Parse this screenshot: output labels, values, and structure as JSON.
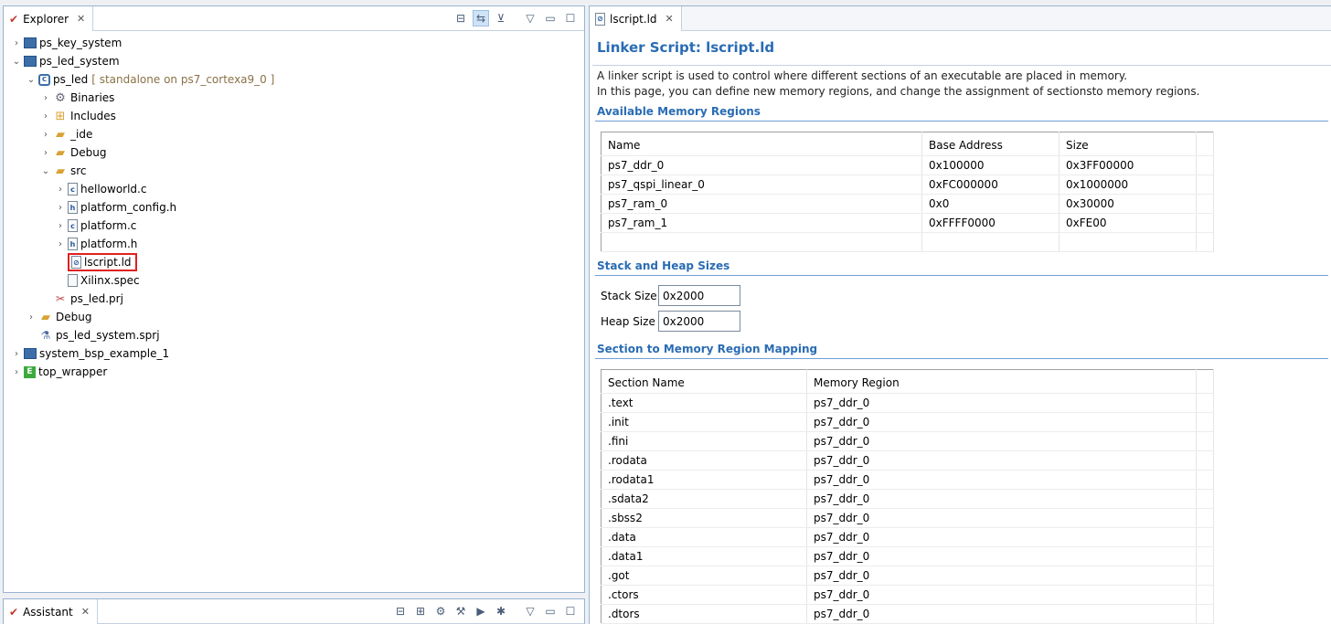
{
  "explorer": {
    "tab_label": "Explorer",
    "tree": [
      {
        "label": "ps_key_system",
        "muted": "",
        "icon": "system",
        "level": 0,
        "twisty": "›"
      },
      {
        "label": "ps_led_system",
        "muted": "",
        "icon": "system",
        "level": 0,
        "twisty": "⌄"
      },
      {
        "label": "ps_led",
        "muted": "[ standalone on ps7_cortexa9_0 ]",
        "icon": "application",
        "level": 1,
        "twisty": "⌄"
      },
      {
        "label": "Binaries",
        "muted": "",
        "icon": "gear",
        "level": 2,
        "twisty": "›"
      },
      {
        "label": "Includes",
        "muted": "",
        "icon": "includes",
        "level": 2,
        "twisty": "›"
      },
      {
        "label": "_ide",
        "muted": "",
        "icon": "folder",
        "level": 2,
        "twisty": "›"
      },
      {
        "label": "Debug",
        "muted": "",
        "icon": "folder",
        "level": 2,
        "twisty": "›"
      },
      {
        "label": "src",
        "muted": "",
        "icon": "folder",
        "level": 2,
        "twisty": "⌄"
      },
      {
        "label": "helloworld.c",
        "muted": "",
        "icon": "c-file",
        "level": 3,
        "twisty": "›"
      },
      {
        "label": "platform_config.h",
        "muted": "",
        "icon": "h-file",
        "level": 3,
        "twisty": "›"
      },
      {
        "label": "platform.c",
        "muted": "",
        "icon": "c-file",
        "level": 3,
        "twisty": "›"
      },
      {
        "label": "platform.h",
        "muted": "",
        "icon": "h-file",
        "level": 3,
        "twisty": "›"
      },
      {
        "label": "lscript.ld",
        "muted": "",
        "icon": "linker-file",
        "level": 3,
        "twisty": ""
      },
      {
        "label": "Xilinx.spec",
        "muted": "",
        "icon": "file",
        "level": 3,
        "twisty": ""
      },
      {
        "label": "ps_led.prj",
        "muted": "",
        "icon": "tools",
        "level": 2,
        "twisty": ""
      },
      {
        "label": "Debug",
        "muted": "",
        "icon": "folder",
        "level": 1,
        "twisty": "›"
      },
      {
        "label": "ps_led_system.sprj",
        "muted": "",
        "icon": "flask",
        "level": 1,
        "twisty": ""
      },
      {
        "label": "system_bsp_example_1",
        "muted": "",
        "icon": "system",
        "level": 0,
        "twisty": "›"
      },
      {
        "label": "top_wrapper",
        "muted": "",
        "icon": "platform",
        "level": 0,
        "twisty": "›"
      }
    ]
  },
  "assistant": {
    "tab_label": "Assistant"
  },
  "editor": {
    "tab_label": "lscript.ld",
    "title": "Linker Script: lscript.ld",
    "desc_line1": "A linker script is used to control where different sections of an executable are placed in memory.",
    "desc_line2": "In this page, you can define new memory regions, and change the assignment of sectionsto memory regions.",
    "memory": {
      "heading": "Available Memory Regions",
      "columns": [
        "Name",
        "Base Address",
        "Size"
      ],
      "rows": [
        [
          "ps7_ddr_0",
          "0x100000",
          "0x3FF00000"
        ],
        [
          "ps7_qspi_linear_0",
          "0xFC000000",
          "0x1000000"
        ],
        [
          "ps7_ram_0",
          "0x0",
          "0x30000"
        ],
        [
          "ps7_ram_1",
          "0xFFFF0000",
          "0xFE00"
        ]
      ]
    },
    "stack": {
      "heading": "Stack and Heap Sizes",
      "stack_label": "Stack Size",
      "stack_value": "0x2000",
      "heap_label": "Heap Size",
      "heap_value": "0x2000"
    },
    "mapping": {
      "heading": "Section to Memory Region Mapping",
      "columns": [
        "Section Name",
        "Memory Region"
      ],
      "rows": [
        [
          ".text",
          "ps7_ddr_0"
        ],
        [
          ".init",
          "ps7_ddr_0"
        ],
        [
          ".fini",
          "ps7_ddr_0"
        ],
        [
          ".rodata",
          "ps7_ddr_0"
        ],
        [
          ".rodata1",
          "ps7_ddr_0"
        ],
        [
          ".sdata2",
          "ps7_ddr_0"
        ],
        [
          ".sbss2",
          "ps7_ddr_0"
        ],
        [
          ".data",
          "ps7_ddr_0"
        ],
        [
          ".data1",
          "ps7_ddr_0"
        ],
        [
          ".got",
          "ps7_ddr_0"
        ],
        [
          ".ctors",
          "ps7_ddr_0"
        ],
        [
          ".dtors",
          "ps7_ddr_0"
        ]
      ]
    }
  },
  "colors": {
    "accent": "#2a6cb4",
    "selection_box": "#e02020",
    "border": "#99b4d1"
  }
}
